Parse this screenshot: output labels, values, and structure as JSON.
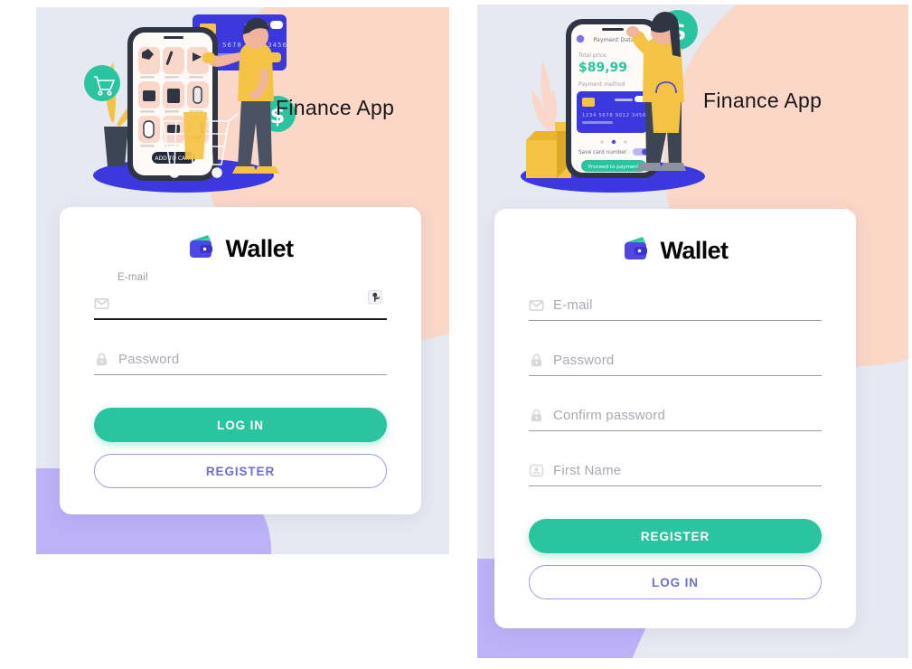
{
  "theme": {
    "panel_bg": "#e7e9f2",
    "blob_pink": "#fbd7c8",
    "blob_purple": "#bdb2f8",
    "accent_green": "#2bc4a0",
    "accent_indigo": "#6b6fd8",
    "wallet_blue": "#4f46e5",
    "text_dark": "#18181b",
    "placeholder": "#a9a9b2"
  },
  "login_screen": {
    "hero_title": "Finance App",
    "illustration": {
      "name": "man-shopping-with-phone-and-credit-card",
      "phone_label": "ADD TO CART",
      "card_number": "1234 5678 9012 3456",
      "badges": [
        "shopping-cart-icon",
        "dollar-coin-icon"
      ]
    },
    "brand": {
      "logo_icon": "wallet-icon",
      "name": "Wallet"
    },
    "fields": [
      {
        "name": "email",
        "icon": "envelope-icon",
        "label": "E-mail",
        "placeholder": "",
        "value": "",
        "focused": true,
        "trailing_icon": "password-key-icon"
      },
      {
        "name": "password",
        "icon": "lock-icon",
        "label": "",
        "placeholder": "Password",
        "value": "",
        "focused": false,
        "trailing_icon": ""
      }
    ],
    "primary_button": "LOG IN",
    "secondary_button": "REGISTER"
  },
  "register_screen": {
    "hero_title": "Finance App",
    "illustration": {
      "name": "woman-paying-with-phone",
      "phone_header": "Payment Data",
      "total_price_label": "Total price",
      "total_price_value": "$89,99",
      "payment_method_label": "Payment method",
      "card_number": "1234 5678 9012 3456",
      "save_card_label": "Save card number",
      "proceed_button": "Proceed to payment",
      "badges": [
        "dollar-coin-icon"
      ]
    },
    "brand": {
      "logo_icon": "wallet-icon",
      "name": "Wallet"
    },
    "fields": [
      {
        "name": "email",
        "icon": "envelope-icon",
        "label": "",
        "placeholder": "E-mail",
        "value": "",
        "focused": false,
        "trailing_icon": ""
      },
      {
        "name": "password",
        "icon": "lock-icon",
        "label": "",
        "placeholder": "Password",
        "value": "",
        "focused": false,
        "trailing_icon": ""
      },
      {
        "name": "confirm-password",
        "icon": "lock-icon",
        "label": "",
        "placeholder": "Confirm password",
        "value": "",
        "focused": false,
        "trailing_icon": ""
      },
      {
        "name": "first-name",
        "icon": "user-icon",
        "label": "",
        "placeholder": "First Name",
        "value": "",
        "focused": false,
        "trailing_icon": ""
      }
    ],
    "primary_button": "REGISTER",
    "secondary_button": "LOG IN"
  }
}
